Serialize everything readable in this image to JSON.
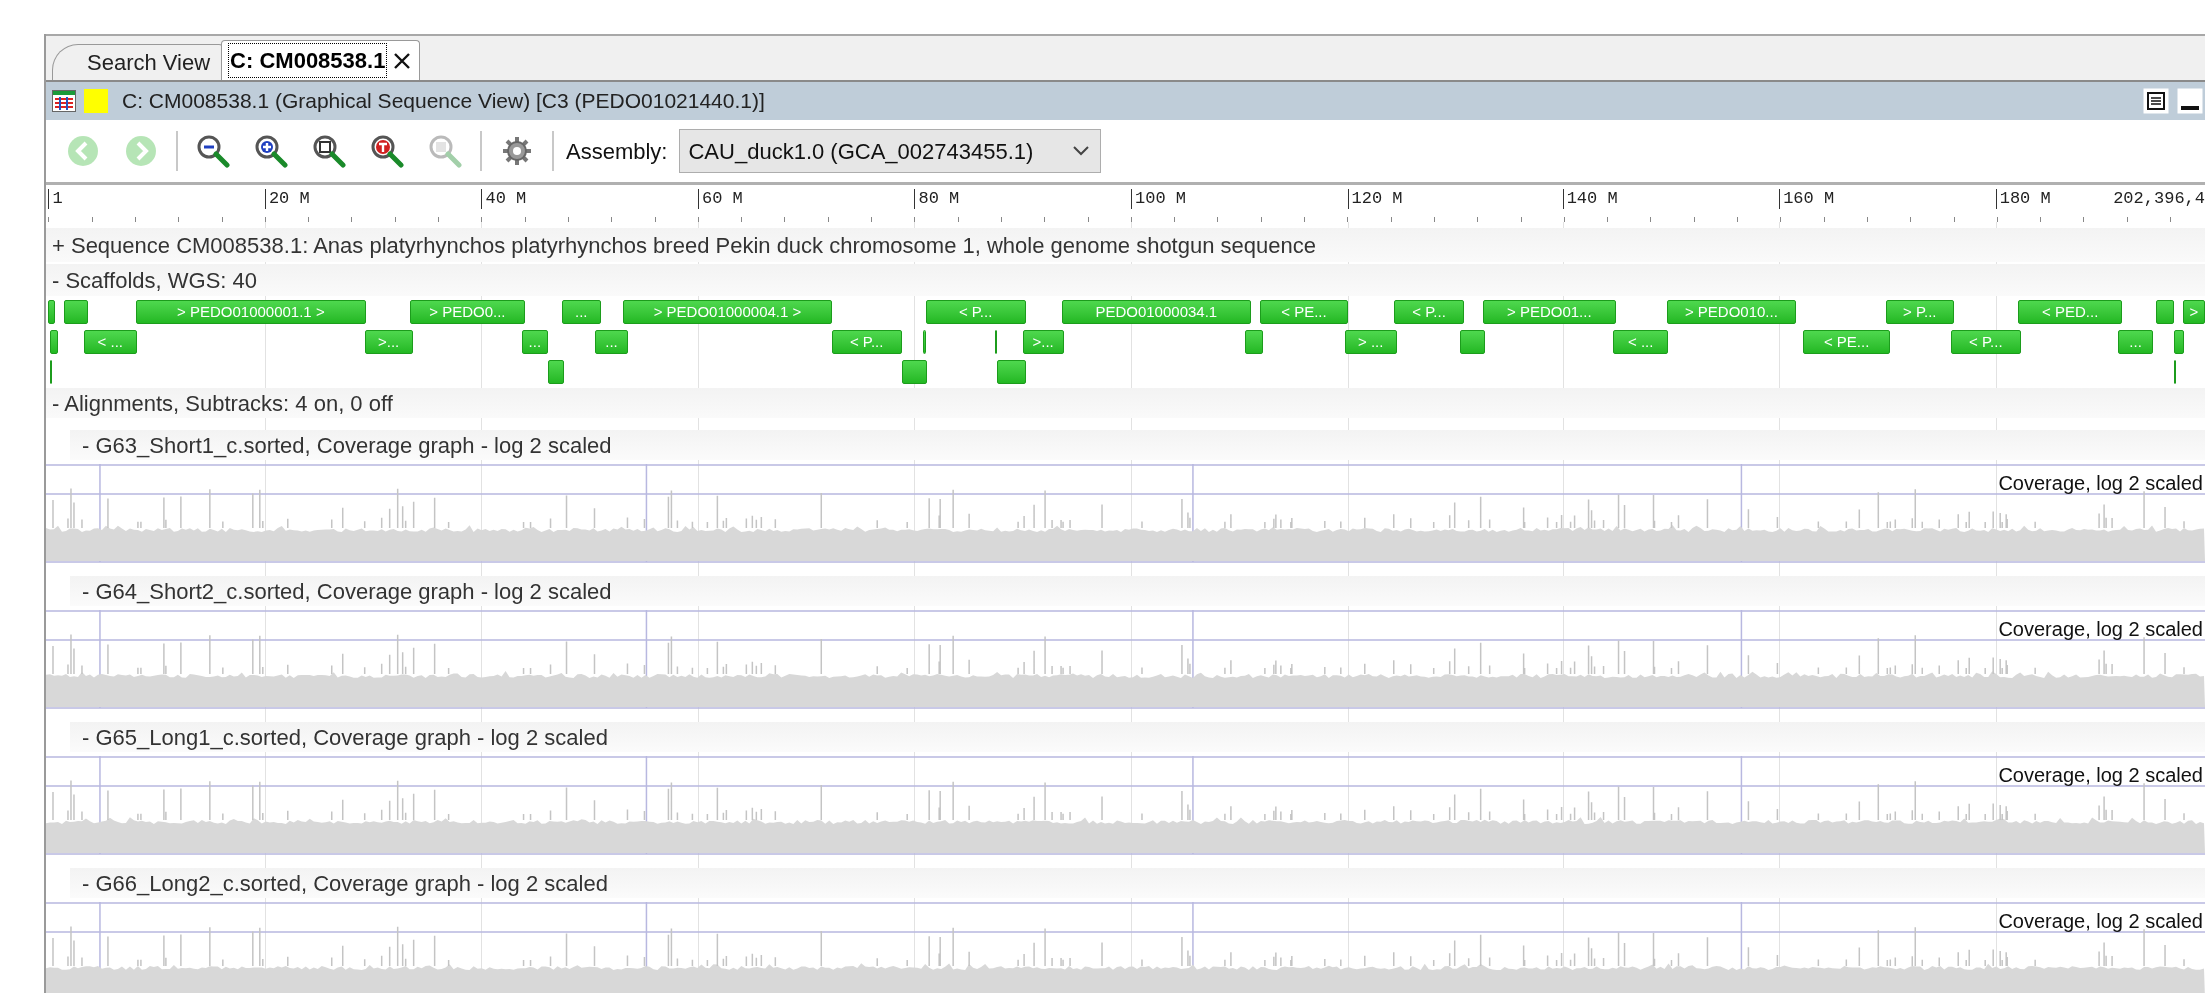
{
  "tabs": [
    {
      "label": "Search View",
      "selected": false,
      "closable": false
    },
    {
      "label": "C: CM008538.1",
      "selected": true,
      "closable": true
    }
  ],
  "view_title": "C: CM008538.1 (Graphical Sequence View) [C3 (PEDO01021440.1)]",
  "toolbar": {
    "buttons": [
      {
        "kind": "back",
        "disabled": true
      },
      {
        "kind": "forward",
        "disabled": true
      },
      {
        "kind": "zoom-out",
        "disabled": false
      },
      {
        "kind": "zoom-in",
        "disabled": false
      },
      {
        "kind": "zoom-fit",
        "disabled": false
      },
      {
        "kind": "zoom-text",
        "disabled": false
      },
      {
        "kind": "zoom-selection",
        "disabled": true
      },
      {
        "kind": "settings",
        "disabled": false
      }
    ],
    "assembly_label": "Assembly:",
    "assembly_value": "CAU_duck1.0 (GCA_002743455.1)"
  },
  "ruler": {
    "ticks": [
      "1",
      "20 M",
      "40 M",
      "60 M",
      "80 M",
      "100 M",
      "120 M",
      "140 M",
      "160 M",
      "180 M"
    ],
    "end_label": "202,396,4"
  },
  "sequence_row": "+ Sequence CM008538.1: Anas platyrhynchos platyrhynchos breed Pekin duck chromosome 1, whole genome shotgun sequence",
  "scaffolds": {
    "title": "- Scaffolds, WGS: 40",
    "lanes": [
      [
        {
          "kind": "bar"
        },
        {
          "kind": "bar"
        },
        {
          "kind": "labeled",
          "label": "> PEDO01000001.1 >"
        },
        {
          "kind": "labeled",
          "label": "> PEDO0..."
        },
        {
          "kind": "labeled",
          "label": "..."
        },
        {
          "kind": "labeled",
          "label": "> PEDO01000004.1 >"
        },
        {
          "kind": "labeled",
          "label": "< P..."
        },
        {
          "kind": "labeled",
          "label": "PEDO01000034.1"
        },
        {
          "kind": "labeled",
          "label": "< PE..."
        },
        {
          "kind": "labeled",
          "label": "< P..."
        },
        {
          "kind": "labeled",
          "label": "> PEDO01..."
        },
        {
          "kind": "labeled",
          "label": "> PEDO010..."
        },
        {
          "kind": "labeled",
          "label": "> P..."
        },
        {
          "kind": "labeled",
          "label": "< PED..."
        },
        {
          "kind": "bar"
        },
        {
          "kind": "labeled",
          "label": ">"
        }
      ],
      [
        {
          "kind": "bar"
        },
        {
          "kind": "labeled",
          "label": "< ..."
        },
        {
          "kind": "labeled",
          "label": ">..."
        },
        {
          "kind": "labeled",
          "label": "..."
        },
        {
          "kind": "labeled",
          "label": "..."
        },
        {
          "kind": "labeled",
          "label": "< P..."
        },
        {
          "kind": "bar"
        },
        {
          "kind": "bar"
        },
        {
          "kind": "labeled",
          "label": ">..."
        },
        {
          "kind": "bar"
        },
        {
          "kind": "labeled",
          "label": "> ..."
        },
        {
          "kind": "bar"
        },
        {
          "kind": "labeled",
          "label": "< ..."
        },
        {
          "kind": "labeled",
          "label": "< PE..."
        },
        {
          "kind": "labeled",
          "label": "< P..."
        },
        {
          "kind": "labeled",
          "label": "..."
        },
        {
          "kind": "bar"
        }
      ],
      [
        {
          "kind": "bar"
        },
        {
          "kind": "bar"
        },
        {
          "kind": "bar"
        },
        {
          "kind": "bar"
        },
        {
          "kind": "bar"
        }
      ]
    ]
  },
  "alignments": {
    "title": "- Alignments, Subtracks: 4 on, 0 off",
    "tracks": [
      {
        "title": "- G63_Short1_c.sorted, Coverage graph - log 2 scaled",
        "graph_label": "Coverage, log 2 scaled"
      },
      {
        "title": "- G64_Short2_c.sorted, Coverage graph - log 2 scaled",
        "graph_label": "Coverage, log 2 scaled"
      },
      {
        "title": "- G65_Long1_c.sorted, Coverage graph - log 2 scaled",
        "graph_label": "Coverage, log 2 scaled"
      },
      {
        "title": "- G66_Long2_c.sorted, Coverage graph - log 2 scaled",
        "graph_label": "Coverage, log 2 scaled"
      }
    ]
  }
}
